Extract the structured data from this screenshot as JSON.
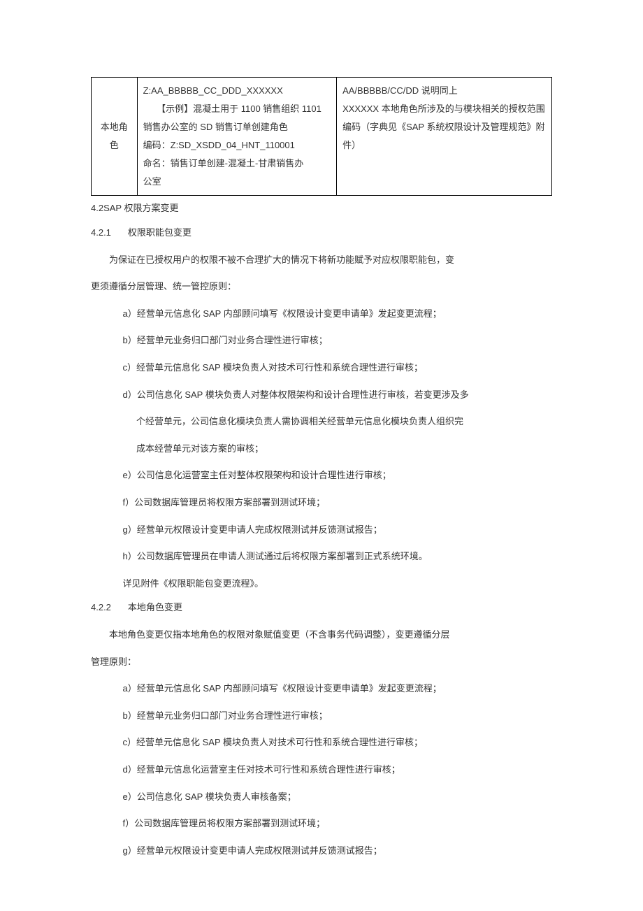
{
  "table": {
    "row_label": "本地角色",
    "mid_lines": [
      "Z:AA_BBBBB_CC_DDD_XXXXXX",
      "　　【示例】混凝土用于 1100 销售组织 1101",
      "销售办公室的 SD 销售订单创建角色",
      "编码：Z:SD_XSDD_04_HNT_110001",
      "命名：销售订单创建-混凝土-甘肃销售办",
      "公室"
    ],
    "right_lines": [
      "AA/BBBBB/CC/DD 说明同上",
      "XXXXXX 本地角色所涉及的与模块相关的授权范围",
      "编码（字典见《SAP 系统权限设计及管理规范》附件）"
    ]
  },
  "h42": "4.2SAP 权限方案变更",
  "s421": {
    "num": "4.2.1",
    "title": "权限职能包变更"
  },
  "p421_1": "为保证在已授权用户的权限不被不合理扩大的情况下将新功能赋予对应权限职能包，变",
  "p421_2": "更须遵循分层管理、统一管控原则：",
  "l421": [
    "a）经营单元信息化 SAP 内部顾问填写《权限设计变更申请单》发起变更流程；",
    "b）经营单元业务归口部门对业务合理性进行审核；",
    "c）经营单元信息化 SAP 模块负责人对技术可行性和系统合理性进行审核；",
    "d）公司信息化 SAP 模块负责人对整体权限架构和设计合理性进行审核，若变更涉及多",
    "e）公司信息化运营室主任对整体权限架构和设计合理性进行审核；",
    "f）公司数据库管理员将权限方案部署到测试环境；",
    "g）经营单元权限设计变更申请人完成权限测试并反馈测试报告；",
    "h）公司数据库管理员在申请人测试通过后将权限方案部署到正式系统环境。"
  ],
  "l421_d_cont1": "个经营单元，公司信息化模块负责人需协调相关经营单元信息化模块负责人组织完",
  "l421_d_cont2": "成本经营单元对该方案的审核；",
  "p421_end": "详见附件《权限职能包变更流程》。",
  "s422": {
    "num": "4.2.2",
    "title": "本地角色变更"
  },
  "p422_1": "本地角色变更仅指本地角色的权限对象赋值变更（不含事务代码调整），变更遵循分层",
  "p422_2": "管理原则：",
  "l422": [
    "a）经营单元信息化 SAP 内部顾问填写《权限设计变更申请单》发起变更流程；",
    "b）经营单元业务归口部门对业务合理性进行审核；",
    "c）经营单元信息化 SAP 模块负责人对技术可行性和系统合理性进行审核；",
    "d）经营单元信息化运营室主任对技术可行性和系统合理性进行审核；",
    "e）公司信息化 SAP 模块负责人审核备案；",
    "f）公司数据库管理员将权限方案部署到测试环境；",
    "g）经营单元权限设计变更申请人完成权限测试并反馈测试报告；"
  ]
}
